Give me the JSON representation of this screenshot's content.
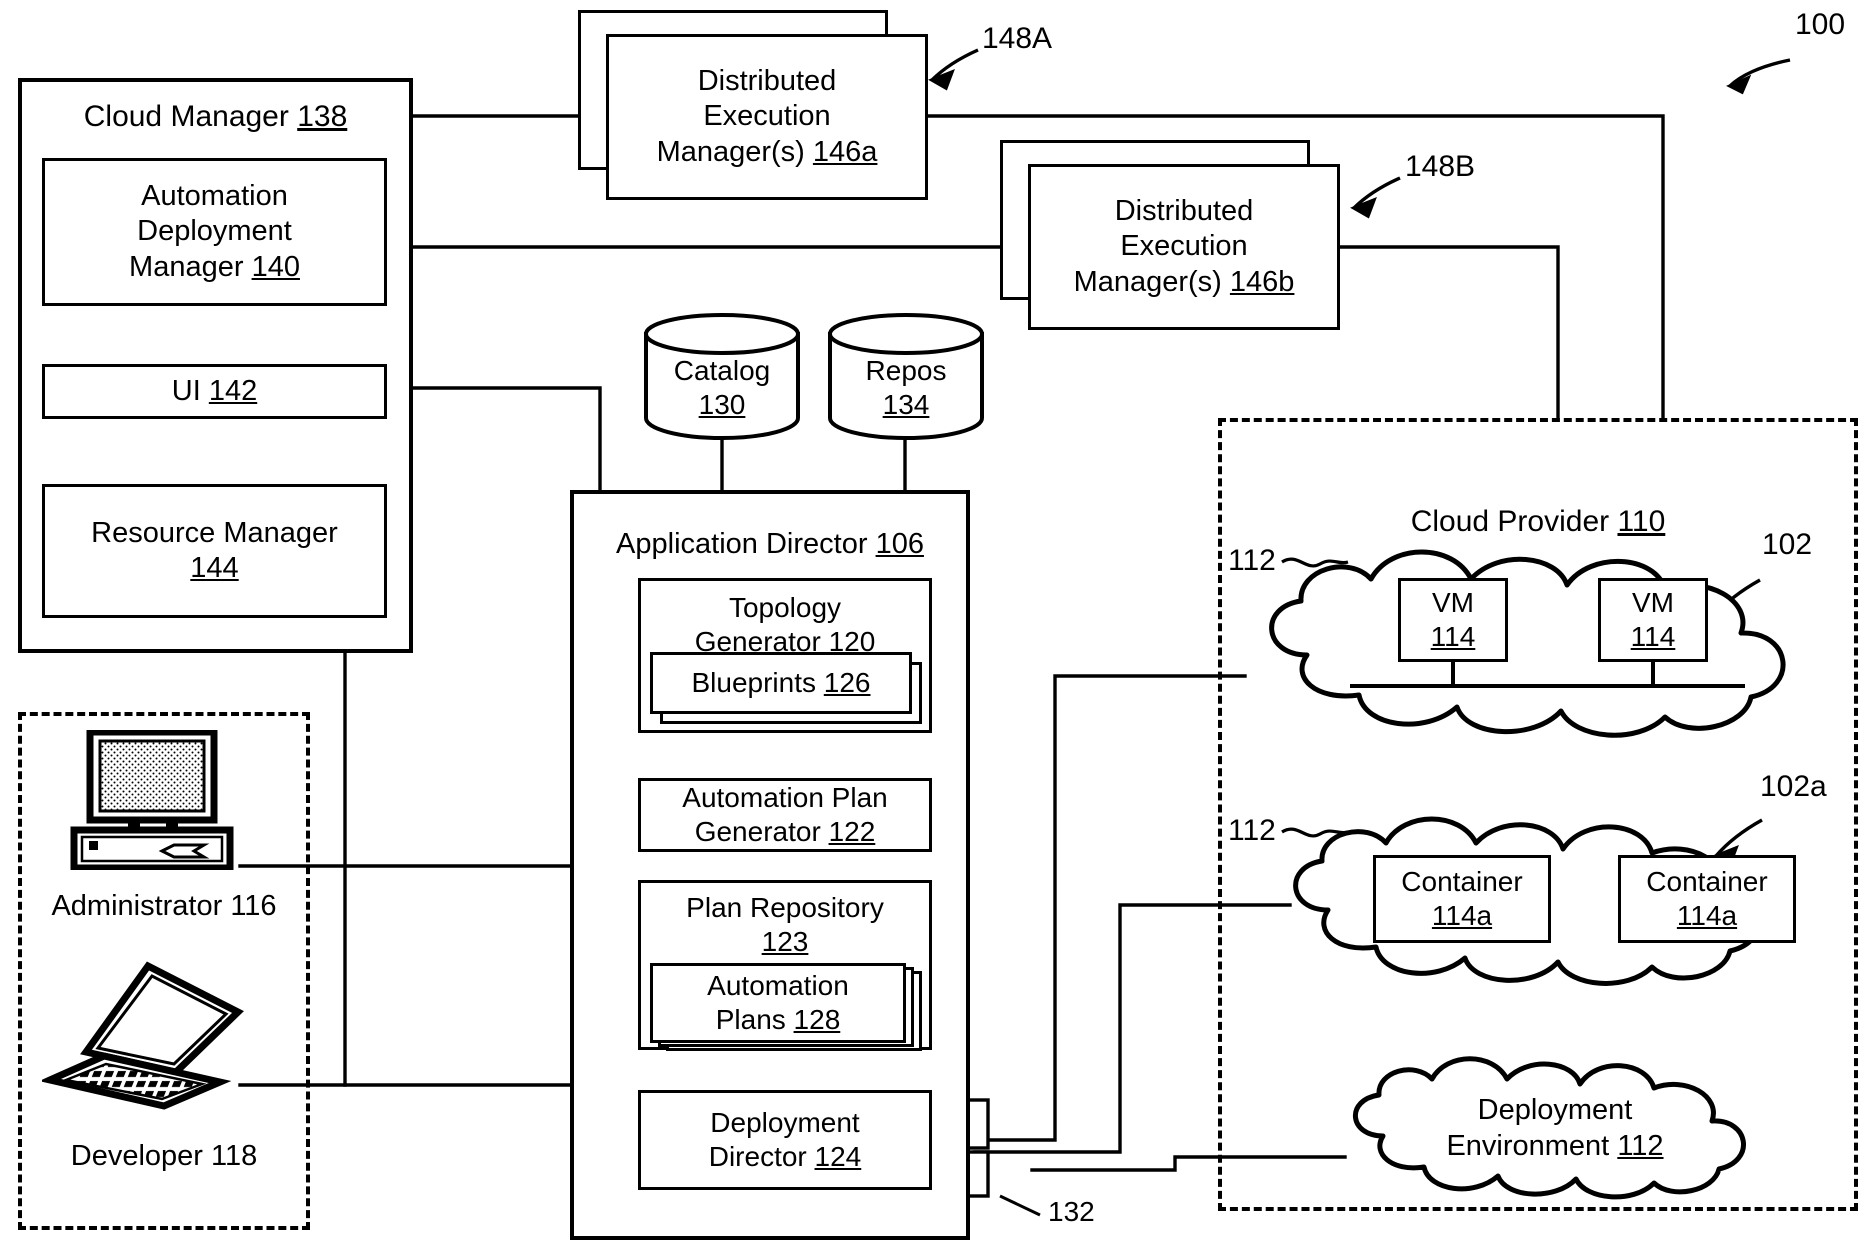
{
  "figure": {
    "number": "100",
    "cloud_manager": {
      "title": "Cloud Manager",
      "ref": "138",
      "items": [
        {
          "lines": [
            "Automation",
            "Deployment",
            "Manager"
          ],
          "ref": "140"
        },
        {
          "lines": [
            "UI"
          ],
          "ref": "142"
        },
        {
          "lines": [
            "Resource Manager"
          ],
          "ref": "144"
        }
      ]
    },
    "dem_a": {
      "lines": [
        "Distributed",
        "Execution",
        "Manager(s)"
      ],
      "ref": "146a",
      "callout": "148A"
    },
    "dem_b": {
      "lines": [
        "Distributed",
        "Execution",
        "Manager(s)"
      ],
      "ref": "146b",
      "callout": "148B"
    },
    "datastores": [
      {
        "name": "Catalog",
        "ref": "130"
      },
      {
        "name": "Repos",
        "ref": "134"
      }
    ],
    "application_director": {
      "title": "Application Director",
      "ref": "106",
      "modules": [
        {
          "lines": [
            "Topology",
            "Generator"
          ],
          "ref": "120",
          "child": {
            "lines": [
              "Blueprints"
            ],
            "ref": "126",
            "stacked": true
          }
        },
        {
          "lines": [
            "Automation Plan",
            "Generator"
          ],
          "ref": "122"
        },
        {
          "lines": [
            "Plan Repository"
          ],
          "ref": "123",
          "child": {
            "lines": [
              "Automation",
              "Plans"
            ],
            "ref": "128",
            "stacked": true
          }
        },
        {
          "lines": [
            "Deployment",
            "Director"
          ],
          "ref": "124"
        }
      ],
      "connector_ref": "132"
    },
    "actors": [
      {
        "label": "Administrator",
        "ref": "116",
        "icon": "desktop-computer-icon"
      },
      {
        "label": "Developer",
        "ref": "118",
        "icon": "laptop-computer-icon"
      }
    ],
    "cloud_provider": {
      "title": "Cloud Provider",
      "ref": "110",
      "environments": [
        {
          "id": "vm-cloud",
          "callout": "102",
          "env_ref": "112",
          "nodes": [
            {
              "label": "VM",
              "ref": "114"
            },
            {
              "label": "VM",
              "ref": "114"
            }
          ]
        },
        {
          "id": "container-cloud",
          "callout": "102a",
          "env_ref": "112",
          "nodes": [
            {
              "label": "Container",
              "ref": "114a"
            },
            {
              "label": "Container",
              "ref": "114a"
            }
          ]
        },
        {
          "id": "deployment-env-cloud",
          "lines": [
            "Deployment",
            "Environment"
          ],
          "ref": "112"
        }
      ]
    }
  },
  "style": {
    "line_color": "#000000",
    "fill_color": "#ffffff"
  }
}
